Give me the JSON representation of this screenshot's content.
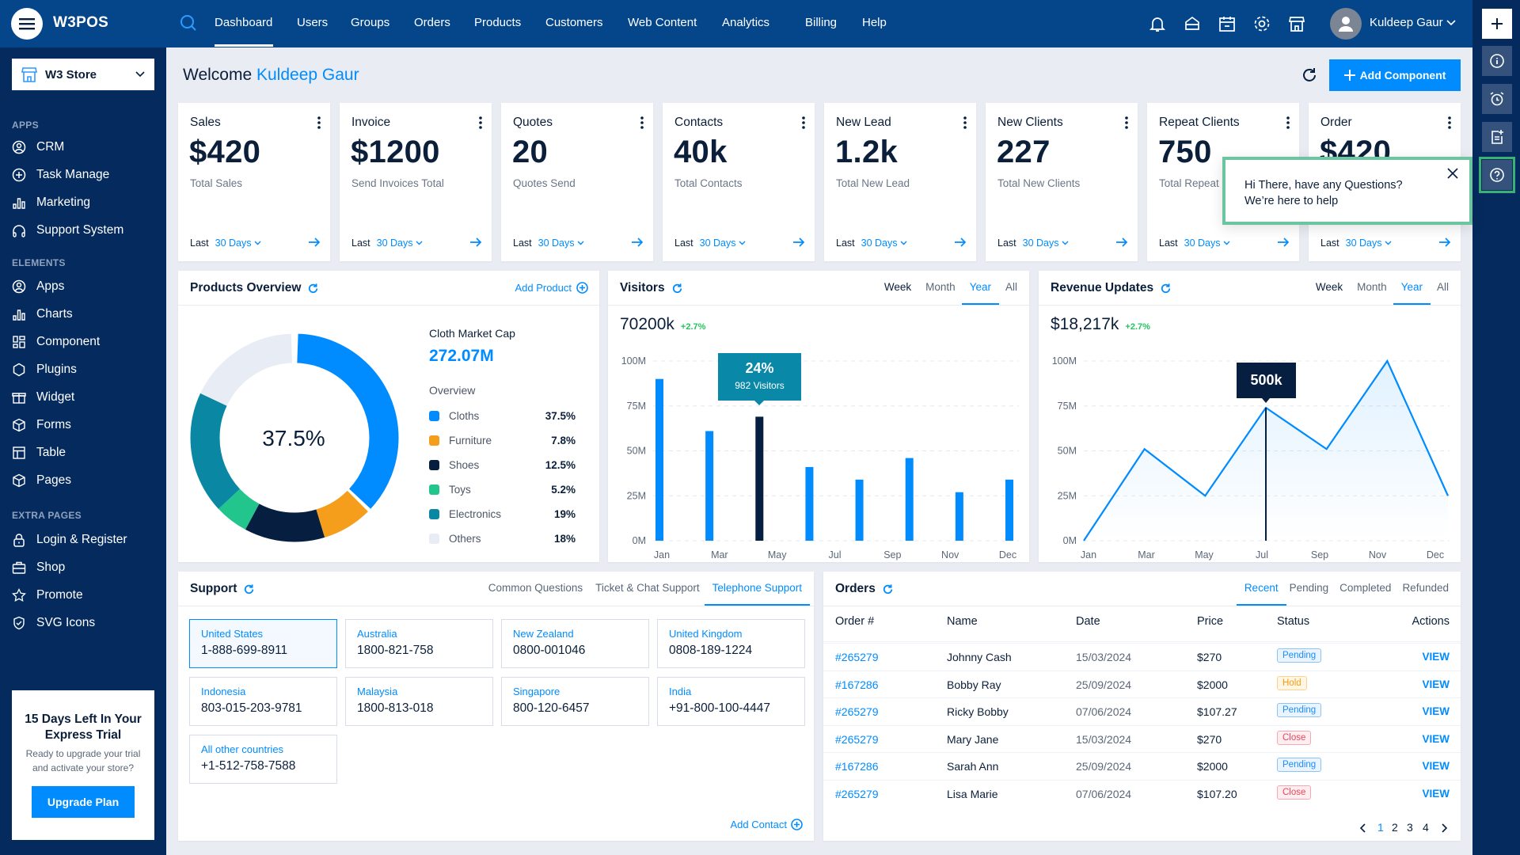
{
  "app": {
    "logo": "W3POS"
  },
  "topnav": {
    "items": [
      "Dashboard",
      "Users",
      "Groups",
      "Orders",
      "Products",
      "Customers",
      "Web Content",
      "Analytics",
      "Billing",
      "Help"
    ],
    "active": "Dashboard",
    "icons": [
      "bell-icon",
      "inbox-icon",
      "calendar-icon",
      "gear-icon",
      "store-icon"
    ],
    "user_name": "Kuldeep Gaur"
  },
  "rail": {
    "buttons": [
      "plus-icon",
      "info-icon",
      "alarm-icon",
      "notes-icon",
      "help-icon"
    ]
  },
  "help_tooltip": {
    "line1": "Hi There, have any Questions?",
    "line2": "We’re here to help"
  },
  "sidebar": {
    "store": "W3 Store",
    "sections": [
      {
        "label": "APPS",
        "items": [
          {
            "label": "CRM",
            "icon": "user-circle"
          },
          {
            "label": "Task Manage",
            "icon": "plus-circle"
          },
          {
            "label": "Marketing",
            "icon": "bar-chart"
          },
          {
            "label": "Support System",
            "icon": "headphones"
          }
        ]
      },
      {
        "label": "ELEMENTS",
        "items": [
          {
            "label": "Apps",
            "icon": "user-circle"
          },
          {
            "label": "Charts",
            "icon": "bar-chart"
          },
          {
            "label": "Component",
            "icon": "grid"
          },
          {
            "label": "Plugins",
            "icon": "hexagon"
          },
          {
            "label": "Widget",
            "icon": "gift"
          },
          {
            "label": "Forms",
            "icon": "box"
          },
          {
            "label": "Table",
            "icon": "table"
          },
          {
            "label": "Pages",
            "icon": "box"
          }
        ]
      },
      {
        "label": "EXTRA PAGES",
        "items": [
          {
            "label": "Login & Register",
            "icon": "lock"
          },
          {
            "label": "Shop",
            "icon": "briefcase"
          },
          {
            "label": "Promote",
            "icon": "star"
          },
          {
            "label": "SVG Icons",
            "icon": "shield"
          }
        ]
      }
    ],
    "trial": {
      "title": "15 Days Left In Your Express Trial",
      "text": "Ready to upgrade your trial and activate your store?",
      "button": "Upgrade Plan"
    }
  },
  "header": {
    "welcome": "Welcome",
    "user": "Kuldeep Gaur",
    "add_component": "Add Component"
  },
  "stats": [
    {
      "title": "Sales",
      "value": "$420",
      "sub": "Total Sales",
      "last": "Last",
      "range": "30 Days"
    },
    {
      "title": "Invoice",
      "value": "$1200",
      "sub": "Send Invoices Total",
      "last": "Last",
      "range": "30 Days"
    },
    {
      "title": "Quotes",
      "value": "20",
      "sub": "Quotes Send",
      "last": "Last",
      "range": "30 Days"
    },
    {
      "title": "Contacts",
      "value": "40k",
      "sub": "Total Contacts",
      "last": "Last",
      "range": "30 Days"
    },
    {
      "title": "New Lead",
      "value": "1.2k",
      "sub": "Total New Lead",
      "last": "Last",
      "range": "30 Days"
    },
    {
      "title": "New Clients",
      "value": "227",
      "sub": "Total New Clients",
      "last": "Last",
      "range": "30 Days"
    },
    {
      "title": "Repeat Clients",
      "value": "750",
      "sub": "Total Repeat Clients",
      "last": "Last",
      "range": "30 Days"
    },
    {
      "title": "Order",
      "value": "$420",
      "sub": "",
      "last": "Last",
      "range": "30 Days"
    }
  ],
  "products": {
    "title": "Products Overview",
    "add": "Add Product",
    "center": "37.5%",
    "cap_label": "Cloth Market Cap",
    "cap_value": "272.07M",
    "overview": "Overview",
    "chart_data": {
      "type": "pie",
      "categories": [
        "Cloths",
        "Furniture",
        "Shoes",
        "Toys",
        "Electronics",
        "Others"
      ],
      "values": [
        37.5,
        7.8,
        12.5,
        5.2,
        19,
        18
      ],
      "labels": [
        "37.5%",
        "7.8%",
        "12.5%",
        "5.2%",
        "19%",
        "18%"
      ],
      "colors": [
        "#008cff",
        "#f59e1b",
        "#061f40",
        "#22c58b",
        "#0a88a3",
        "#e8ecf4"
      ]
    }
  },
  "visitors": {
    "title": "Visitors",
    "tabs": [
      "Week",
      "Month",
      "Year",
      "All"
    ],
    "active_tab": "Year",
    "total": "70200k",
    "change": "+2.7%",
    "tooltip": {
      "pct": "24%",
      "text": "982 Visitors"
    },
    "chart_data": {
      "type": "bar",
      "values": [
        90,
        61,
        69,
        41,
        34,
        46,
        27,
        34
      ],
      "highlighted_index": 2,
      "x_tick_labels": [
        "Jan",
        "Mar",
        "May",
        "Jul",
        "Sep",
        "Nov",
        "Dec"
      ],
      "y_ticks": [
        "0M",
        "25M",
        "50M",
        "75M",
        "100M"
      ],
      "ylim": [
        0,
        100
      ],
      "unit": "M",
      "grid": true,
      "bar_color": "#008cff",
      "highlight_color": "#061f40"
    }
  },
  "revenue": {
    "title": "Revenue Updates",
    "tabs": [
      "Week",
      "Month",
      "Year",
      "All"
    ],
    "active_tab": "Year",
    "total": "$18,217k",
    "change": "+2.7%",
    "tooltip": "500k",
    "chart_data": {
      "type": "area",
      "x": [
        "Jan",
        "Mar",
        "May",
        "Jul",
        "Sep",
        "Nov",
        "Dec"
      ],
      "values": [
        0,
        51,
        25,
        74,
        51,
        100,
        25
      ],
      "highlighted_index": 3,
      "y_ticks": [
        "0M",
        "25M",
        "50M",
        "75M",
        "100M"
      ],
      "ylim": [
        0,
        100
      ],
      "unit": "M",
      "grid": true,
      "line_color": "#008cff"
    }
  },
  "support": {
    "title": "Support",
    "tabs": [
      "Common Questions",
      "Ticket & Chat Support",
      "Telephone Support"
    ],
    "active_tab": "Telephone Support",
    "phones": [
      {
        "country": "United States",
        "number": "1-888-699-8911"
      },
      {
        "country": "Australia",
        "number": "1800-821-758"
      },
      {
        "country": "New Zealand",
        "number": "0800-001046"
      },
      {
        "country": "United Kingdom",
        "number": "0808-189-1224"
      },
      {
        "country": "Indonesia",
        "number": "803-015-203-9781"
      },
      {
        "country": "Malaysia",
        "number": "1800-813-018"
      },
      {
        "country": "Singapore",
        "number": "800-120-6457"
      },
      {
        "country": "India",
        "number": "+91-800-100-4447"
      },
      {
        "country": "All other countries",
        "number": "+1-512-758-7588"
      }
    ],
    "add_contact": "Add Contact"
  },
  "orders": {
    "title": "Orders",
    "tabs": [
      "Recent",
      "Pending",
      "Completed",
      "Refunded"
    ],
    "active_tab": "Recent",
    "columns": [
      "Order #",
      "Name",
      "Date",
      "Price",
      "Status",
      "Actions"
    ],
    "rows": [
      {
        "id": "#265279",
        "name": "Johnny Cash",
        "date": "15/03/2024",
        "price": "$270",
        "status": "Pending",
        "action": "VIEW"
      },
      {
        "id": "#167286",
        "name": "Bobby Ray",
        "date": "25/09/2024",
        "price": "$2000",
        "status": "Hold",
        "action": "VIEW"
      },
      {
        "id": "#265279",
        "name": "Ricky Bobby",
        "date": "07/06/2024",
        "price": "$107.27",
        "status": "Pending",
        "action": "VIEW"
      },
      {
        "id": "#265279",
        "name": "Mary Jane",
        "date": "15/03/2024",
        "price": "$270",
        "status": "Close",
        "action": "VIEW"
      },
      {
        "id": "#167286",
        "name": "Sarah Ann",
        "date": "25/09/2024",
        "price": "$2000",
        "status": "Pending",
        "action": "VIEW"
      },
      {
        "id": "#265279",
        "name": "Lisa Marie",
        "date": "07/06/2024",
        "price": "$107.20",
        "status": "Close",
        "action": "VIEW"
      }
    ],
    "pages": [
      "1",
      "2",
      "3",
      "4"
    ],
    "current_page": "1"
  }
}
